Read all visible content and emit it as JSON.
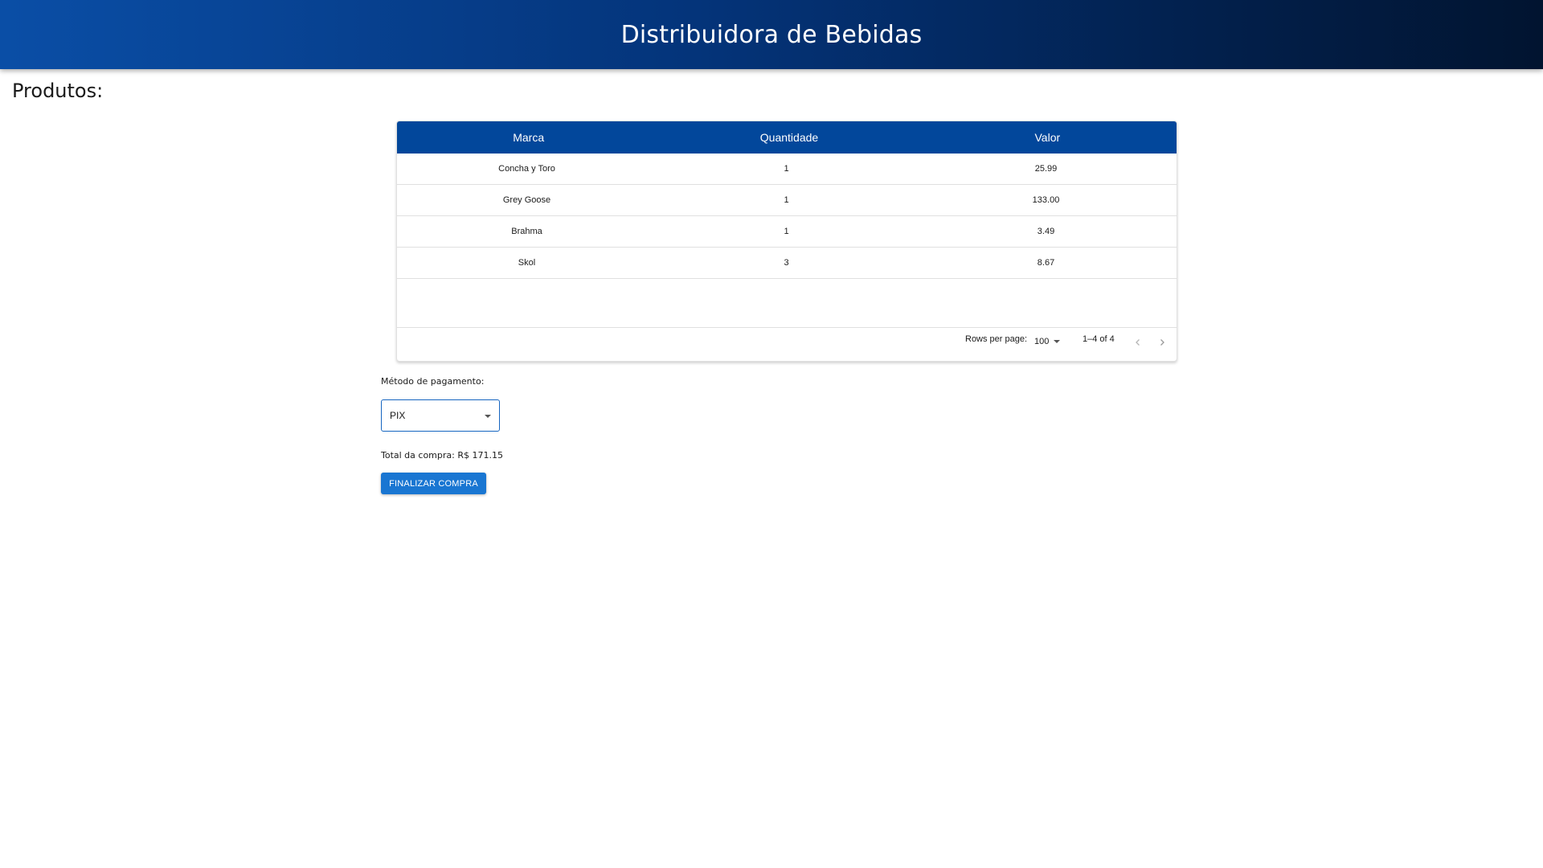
{
  "header": {
    "title": "Distribuidora de Bebidas"
  },
  "section": {
    "title": "Produtos:"
  },
  "table": {
    "columns": [
      "Marca",
      "Quantidade",
      "Valor"
    ],
    "rows": [
      {
        "marca": "Concha y Toro",
        "quantidade": "1",
        "valor": "25.99"
      },
      {
        "marca": "Grey Goose",
        "quantidade": "1",
        "valor": "133.00"
      },
      {
        "marca": "Brahma",
        "quantidade": "1",
        "valor": "3.49"
      },
      {
        "marca": "Skol",
        "quantidade": "3",
        "valor": "8.67"
      }
    ],
    "pagination": {
      "rows_per_page_label": "Rows per page:",
      "rows_per_page_value": "100",
      "range_label": "1–4 of 4",
      "prev_icon": "chevron-left-icon",
      "next_icon": "chevron-right-icon"
    }
  },
  "payment": {
    "label": "Método de pagamento:",
    "selected": "PIX",
    "select_icon": "caret-down-icon"
  },
  "summary": {
    "total_label": "Total da compra: R$ 171.15"
  },
  "actions": {
    "finalize_label": "FINALIZAR COMPRA"
  },
  "colors": {
    "header_gradient_start": "#0a4ea6",
    "header_gradient_end": "#011430",
    "table_header": "#02479b",
    "primary_button": "#1976d2",
    "select_border": "#1565c0"
  }
}
